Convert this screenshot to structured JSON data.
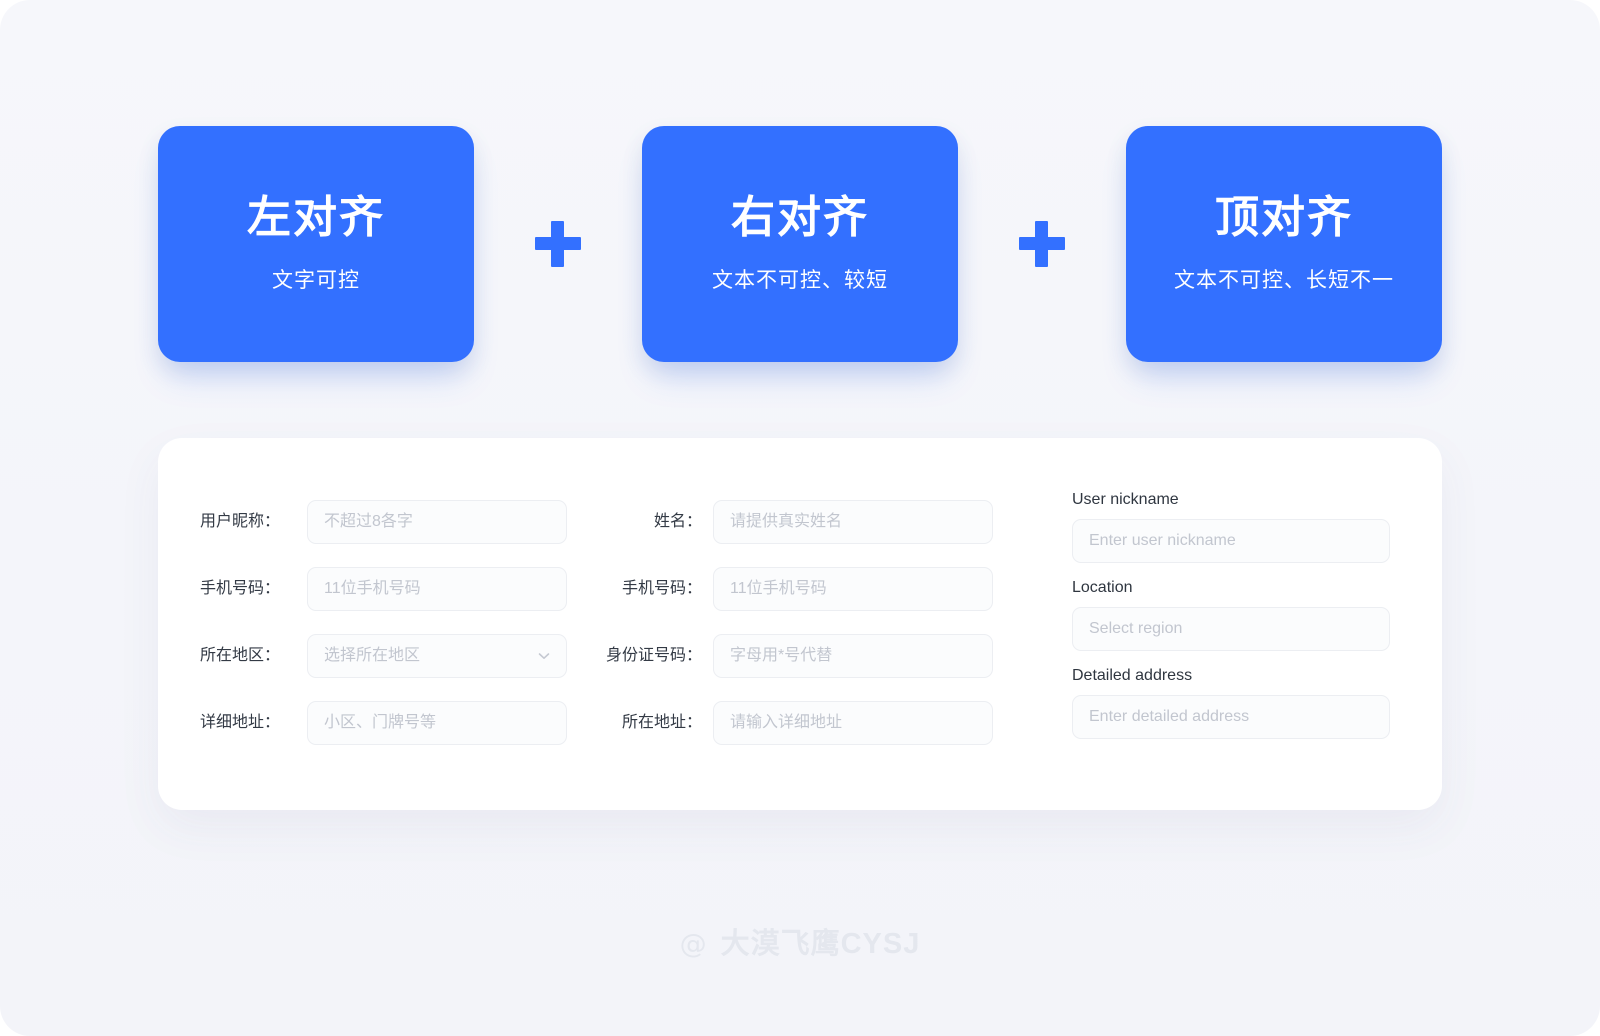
{
  "theme": {
    "accent": "#3370ff",
    "page_bg": "#f5f6fa",
    "panel_bg": "#ffffff",
    "label_color": "#333a45",
    "placeholder_color": "#c2c6cf",
    "watermark_color": "#e4e7ee"
  },
  "concept_cards": [
    {
      "title": "左对齐",
      "subtitle": "文字可控"
    },
    {
      "title": "右对齐",
      "subtitle": "文本不可控、较短"
    },
    {
      "title": "顶对齐",
      "subtitle": "文本不可控、长短不一"
    }
  ],
  "separators": [
    {
      "icon": "plus-icon",
      "label": "+"
    },
    {
      "icon": "plus-icon",
      "label": "+"
    }
  ],
  "form_columns": {
    "left_aligned": {
      "fields": [
        {
          "label": "用户昵称：",
          "placeholder": "不超过8各字",
          "value": "",
          "type": "text"
        },
        {
          "label": "手机号码：",
          "placeholder": "11位手机号码",
          "value": "",
          "type": "text"
        },
        {
          "label": "所在地区：",
          "placeholder": "选择所在地区",
          "value": "",
          "type": "select",
          "icon": "chevron-down-icon"
        },
        {
          "label": "详细地址：",
          "placeholder": "小区、门牌号等",
          "value": "",
          "type": "text"
        }
      ]
    },
    "right_aligned": {
      "fields": [
        {
          "label": "姓名：",
          "placeholder": "请提供真实姓名",
          "value": "",
          "type": "text"
        },
        {
          "label": "手机号码：",
          "placeholder": "11位手机号码",
          "value": "",
          "type": "text"
        },
        {
          "label": "身份证号码：",
          "placeholder": "字母用*号代替",
          "value": "",
          "type": "text"
        },
        {
          "label": "所在地址：",
          "placeholder": "请输入详细地址",
          "value": "",
          "type": "text"
        }
      ]
    },
    "top_aligned": {
      "fields": [
        {
          "label": "User nickname",
          "placeholder": "Enter user nickname",
          "value": "",
          "type": "text"
        },
        {
          "label": "Location",
          "placeholder": "Select region",
          "value": "",
          "type": "text"
        },
        {
          "label": "Detailed address",
          "placeholder": "Enter detailed address",
          "value": "",
          "type": "text"
        }
      ]
    }
  },
  "watermark": {
    "at_symbol": "@",
    "text": "大漠飞鹰CYSJ"
  }
}
